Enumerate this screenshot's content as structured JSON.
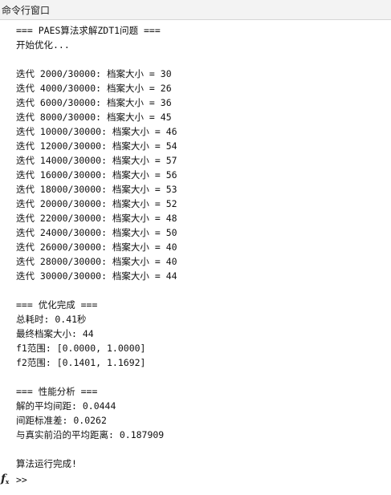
{
  "window": {
    "title": "命令行窗口"
  },
  "console": {
    "lines": [
      "=== PAES算法求解ZDT1问题 ===",
      "开始优化...",
      "",
      "迭代 2000/30000: 档案大小 = 30",
      "迭代 4000/30000: 档案大小 = 26",
      "迭代 6000/30000: 档案大小 = 36",
      "迭代 8000/30000: 档案大小 = 45",
      "迭代 10000/30000: 档案大小 = 46",
      "迭代 12000/30000: 档案大小 = 54",
      "迭代 14000/30000: 档案大小 = 57",
      "迭代 16000/30000: 档案大小 = 56",
      "迭代 18000/30000: 档案大小 = 53",
      "迭代 20000/30000: 档案大小 = 52",
      "迭代 22000/30000: 档案大小 = 48",
      "迭代 24000/30000: 档案大小 = 50",
      "迭代 26000/30000: 档案大小 = 40",
      "迭代 28000/30000: 档案大小 = 40",
      "迭代 30000/30000: 档案大小 = 44",
      "",
      "=== 优化完成 ===",
      "总耗时: 0.41秒",
      "最终档案大小: 44",
      "f1范围: [0.0000, 1.0000]",
      "f2范围: [0.1401, 1.1692]",
      "",
      "=== 性能分析 ===",
      "解的平均间距: 0.0444",
      "间距标准差: 0.0262",
      "与真实前沿的平均距离: 0.187909",
      "",
      "算法运行完成!"
    ],
    "prompt": ">>",
    "fx_icon": "function-fx-icon"
  }
}
